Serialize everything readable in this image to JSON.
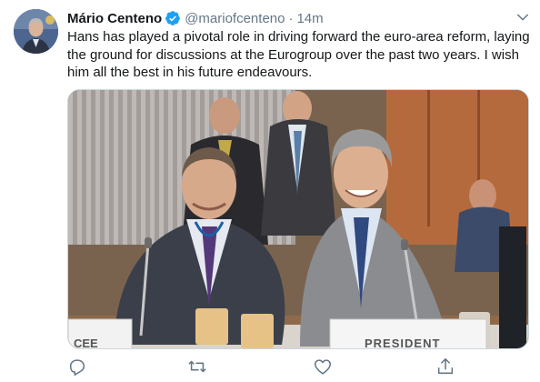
{
  "tweet": {
    "display_name": "Mário Centeno",
    "handle": "@mariofcenteno",
    "separator": "·",
    "time": "14m",
    "text": "Hans has played a pivotal role in driving forward the euro-area reform, laying the ground for discussions at the Eurogroup over the past two years. I wish him all the best in his future endeavours.",
    "verified": true,
    "icons": {
      "verified": "verified-badge-icon",
      "caret": "chevron-down-icon",
      "reply": "reply-icon",
      "retweet": "retweet-icon",
      "like": "heart-icon",
      "share": "share-icon"
    },
    "colors": {
      "text": "#14171a",
      "secondary": "#657786",
      "verified": "#1da1f2"
    }
  },
  "media": {
    "nameplate_left": "CEE",
    "nameplate_right": "PRESIDENT"
  }
}
